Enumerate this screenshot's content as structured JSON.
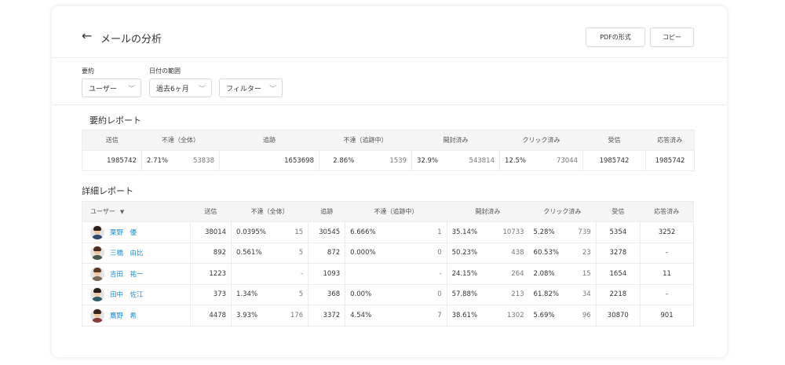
{
  "header": {
    "title": "メールの分析",
    "back_icon": "←",
    "pdf_button": "PDFの形式",
    "copy_button": "コピー"
  },
  "filters": {
    "user_label": "要約",
    "user_value": "ユーザー",
    "date_label": "日付の範囲",
    "date_value": "過去6ヶ月",
    "filter_value": "フィルター",
    "chevron": "﹀"
  },
  "summary": {
    "title": "要約レポート",
    "headers": [
      "送信",
      "不達（全体）",
      "追跡",
      "不達（追跡中）",
      "開封済み",
      "クリック済み",
      "受信",
      "応答済み"
    ],
    "row": {
      "sent": "1985742",
      "bounce_pct": "2.71%",
      "bounce_cnt": "53838",
      "tracked": "1653698",
      "tbounce_pct": "2.86%",
      "tbounce_cnt": "1539",
      "open_pct": "32.9%",
      "open_cnt": "543814",
      "click_pct": "12.5%",
      "click_cnt": "73044",
      "received": "1985742",
      "replied": "1985742"
    }
  },
  "detail": {
    "title": "詳細レポート",
    "headers": [
      "ユーザー",
      "送信",
      "不達（全体）",
      "追跡",
      "不達（追跡中）",
      "開封済み",
      "クリック済み",
      "受信",
      "応答済み"
    ],
    "sort_icon": "▼",
    "rows": [
      {
        "name": "栗野　優",
        "sent": "38014",
        "bounce_pct": "0.0395%",
        "bounce_cnt": "15",
        "tracked": "30545",
        "tbounce_pct": "6.666%",
        "tbounce_cnt": "1",
        "open_pct": "35.14%",
        "open_cnt": "10733",
        "click_pct": "5.28%",
        "click_cnt": "739",
        "received": "5354",
        "replied": "3252"
      },
      {
        "name": "三橋　由比",
        "sent": "892",
        "bounce_pct": "0.561%",
        "bounce_cnt": "5",
        "tracked": "872",
        "tbounce_pct": "0.000%",
        "tbounce_cnt": "0",
        "open_pct": "50.23%",
        "open_cnt": "438",
        "click_pct": "60.53%",
        "click_cnt": "23",
        "received": "3278",
        "replied": "-"
      },
      {
        "name": "吉田　祐一",
        "sent": "1223",
        "bounce_pct": "",
        "bounce_cnt": "-",
        "tracked": "1093",
        "tbounce_pct": "",
        "tbounce_cnt": "-",
        "open_pct": "24.15%",
        "open_cnt": "264",
        "click_pct": "2.08%",
        "click_cnt": "15",
        "received": "1654",
        "replied": "11"
      },
      {
        "name": "田中　佐江",
        "sent": "373",
        "bounce_pct": "1.34%",
        "bounce_cnt": "5",
        "tracked": "368",
        "tbounce_pct": "0.00%",
        "tbounce_cnt": "0",
        "open_pct": "57.88%",
        "open_cnt": "213",
        "click_pct": "61.82%",
        "click_cnt": "34",
        "received": "2218",
        "replied": "-"
      },
      {
        "name": "鷹野　希",
        "sent": "4478",
        "bounce_pct": "3.93%",
        "bounce_cnt": "176",
        "tracked": "3372",
        "tbounce_pct": "4.54%",
        "tbounce_cnt": "7",
        "open_pct": "38.61%",
        "open_cnt": "1302",
        "click_pct": "5.69%",
        "click_cnt": "96",
        "received": "30870",
        "replied": "901"
      }
    ]
  },
  "colors": {
    "link": "#1a8fd6",
    "header_bg": "#f5f5f5",
    "border": "#ececec"
  },
  "avatars": [
    {
      "icon": "avatar-man-icon",
      "shirt": "#2f4a6e",
      "hair": "#2a1f18"
    },
    {
      "icon": "avatar-woman-icon",
      "shirt": "#4a5a4a",
      "hair": "#4a2e1e"
    },
    {
      "icon": "avatar-man-icon",
      "shirt": "#7a6a5a",
      "hair": "#5a3a22"
    },
    {
      "icon": "avatar-man-icon",
      "shirt": "#2e5e66",
      "hair": "#2a1f18"
    },
    {
      "icon": "avatar-woman-icon",
      "shirt": "#8a3a3a",
      "hair": "#3a2218"
    }
  ]
}
